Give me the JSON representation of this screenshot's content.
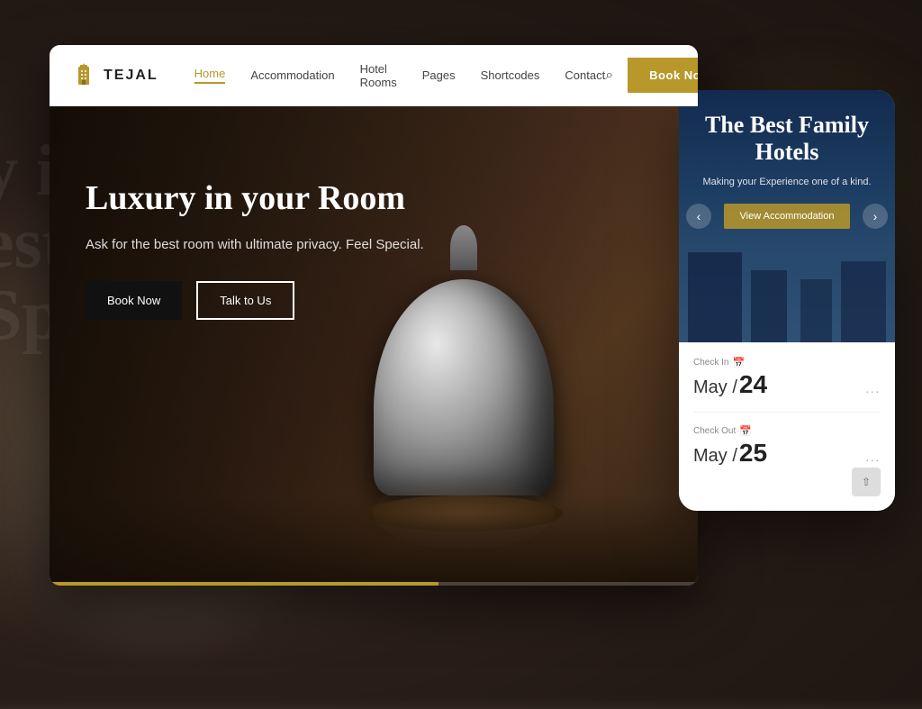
{
  "background": {
    "text_hint": "y i"
  },
  "navbar": {
    "logo_text": "TEJAL",
    "links": [
      {
        "label": "Home",
        "active": true
      },
      {
        "label": "Accommodation",
        "active": false
      },
      {
        "label": "Hotel Rooms",
        "active": false
      },
      {
        "label": "Pages",
        "active": false
      },
      {
        "label": "Shortcodes",
        "active": false
      },
      {
        "label": "Contact",
        "active": false
      }
    ],
    "book_now_label": "Book Now"
  },
  "hero": {
    "title": "Luxury in your Room",
    "subtitle": "Ask for the best room with ultimate privacy. Feel Special.",
    "btn_primary": "Book Now",
    "btn_secondary": "Talk to Us"
  },
  "phone": {
    "hero_title": "The Best Family Hotels",
    "hero_subtitle": "Making your Experience one of a kind.",
    "view_btn": "View Accommodation",
    "checkin_label": "Check In",
    "checkin_month": "May /",
    "checkin_day": "24",
    "checkout_label": "Check Out",
    "checkout_month": "May /",
    "checkout_day": "25",
    "dots": "..."
  }
}
